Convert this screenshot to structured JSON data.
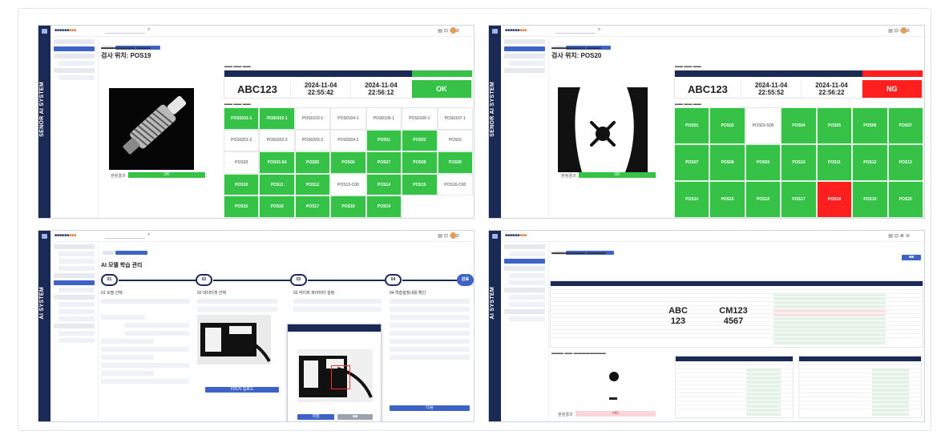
{
  "screens": {
    "s1": {
      "rail_title": "SENOR AI SYSTEM",
      "position": "검사 위치: POS19",
      "result_label": "판정결과",
      "result_value": "OK",
      "info": {
        "id": "ABC123",
        "start_date": "2024-11-04",
        "start_time": "22:55:42",
        "end_date": "2024-11-04",
        "end_time": "22:56:12",
        "status": "OK"
      },
      "grid": [
        {
          "label": "POS0101-1",
          "state": "green"
        },
        {
          "label": "POS0102-1",
          "state": "green"
        },
        {
          "label": "POS0103-1",
          "state": "white"
        },
        {
          "label": "POS0104-1",
          "state": "white"
        },
        {
          "label": "POS0105-1",
          "state": "white"
        },
        {
          "label": "POS0106-1",
          "state": "white"
        },
        {
          "label": "POS0107-1",
          "state": "white"
        },
        {
          "label": "POS0201-2",
          "state": "white"
        },
        {
          "label": "POS0202-2",
          "state": "white"
        },
        {
          "label": "POS0203-2",
          "state": "white"
        },
        {
          "label": "POS0204-2",
          "state": "white"
        },
        {
          "label": "POS01",
          "state": "green"
        },
        {
          "label": "POS02",
          "state": "green"
        },
        {
          "label": "POS03",
          "state": "white"
        },
        {
          "label": "POS03",
          "state": "white"
        },
        {
          "label": "POS03-S4",
          "state": "green"
        },
        {
          "label": "POS05",
          "state": "green"
        },
        {
          "label": "POS06",
          "state": "green"
        },
        {
          "label": "POS07",
          "state": "green"
        },
        {
          "label": "POS08",
          "state": "green"
        },
        {
          "label": "POS09",
          "state": "green"
        },
        {
          "label": "POS10",
          "state": "green"
        },
        {
          "label": "POS11",
          "state": "green"
        },
        {
          "label": "POS12",
          "state": "green"
        },
        {
          "label": "POS13-C00",
          "state": "white"
        },
        {
          "label": "POS14",
          "state": "green"
        },
        {
          "label": "POS15",
          "state": "green"
        },
        {
          "label": "POS16-C00",
          "state": "white"
        },
        {
          "label": "POS15",
          "state": "green"
        },
        {
          "label": "POS16",
          "state": "green"
        },
        {
          "label": "POS17",
          "state": "green"
        },
        {
          "label": "POS18",
          "state": "green"
        },
        {
          "label": "POS19",
          "state": "green"
        }
      ]
    },
    "s2": {
      "rail_title": "SENOR AI SYSTEM",
      "position": "검사 위치: POS20",
      "result_label": "판정결과",
      "result_value": "OK",
      "info": {
        "id": "ABC123",
        "start_date": "2024-11-04",
        "start_time": "22:55:52",
        "end_date": "2024-11-04",
        "end_time": "22:56:22",
        "status": "NG"
      },
      "grid": [
        {
          "label": "POS01",
          "state": "green"
        },
        {
          "label": "POS02",
          "state": "green"
        },
        {
          "label": "POS03-S00",
          "state": "white"
        },
        {
          "label": "POS04",
          "state": "green"
        },
        {
          "label": "POS05",
          "state": "green"
        },
        {
          "label": "POS06",
          "state": "green"
        },
        {
          "label": "POS07",
          "state": "green"
        },
        {
          "label": "POS07",
          "state": "green"
        },
        {
          "label": "POS08",
          "state": "green"
        },
        {
          "label": "POS09",
          "state": "green"
        },
        {
          "label": "POS10",
          "state": "green"
        },
        {
          "label": "POS11",
          "state": "green"
        },
        {
          "label": "POS12",
          "state": "green"
        },
        {
          "label": "POS13",
          "state": "green"
        },
        {
          "label": "POS14",
          "state": "green"
        },
        {
          "label": "POS15",
          "state": "green"
        },
        {
          "label": "POS16",
          "state": "green"
        },
        {
          "label": "POS17",
          "state": "green"
        },
        {
          "label": "POS18",
          "state": "red"
        },
        {
          "label": "POS19",
          "state": "green"
        },
        {
          "label": "POS20",
          "state": "green"
        }
      ]
    },
    "s3": {
      "rail_title": "AI SYSTEM",
      "page_title": "AI 모델 학습 관리",
      "steps": [
        "01",
        "02",
        "03",
        "04",
        "완료"
      ],
      "col_titles": [
        "01 모델 선택",
        "02 데이터셋 선택",
        "03 하이퍼 파라미터 설정",
        "04 학습설정내용 확인"
      ],
      "buttons": {
        "upload": "이미지 업로드",
        "save": "저장",
        "next": "다음"
      }
    },
    "s4": {
      "rail_title": "AI SYSTEM",
      "big_code_1": "ABC\n123",
      "big_code_2": "CM123\n4567",
      "result_label": "판정결과",
      "result_value": "NG"
    }
  }
}
